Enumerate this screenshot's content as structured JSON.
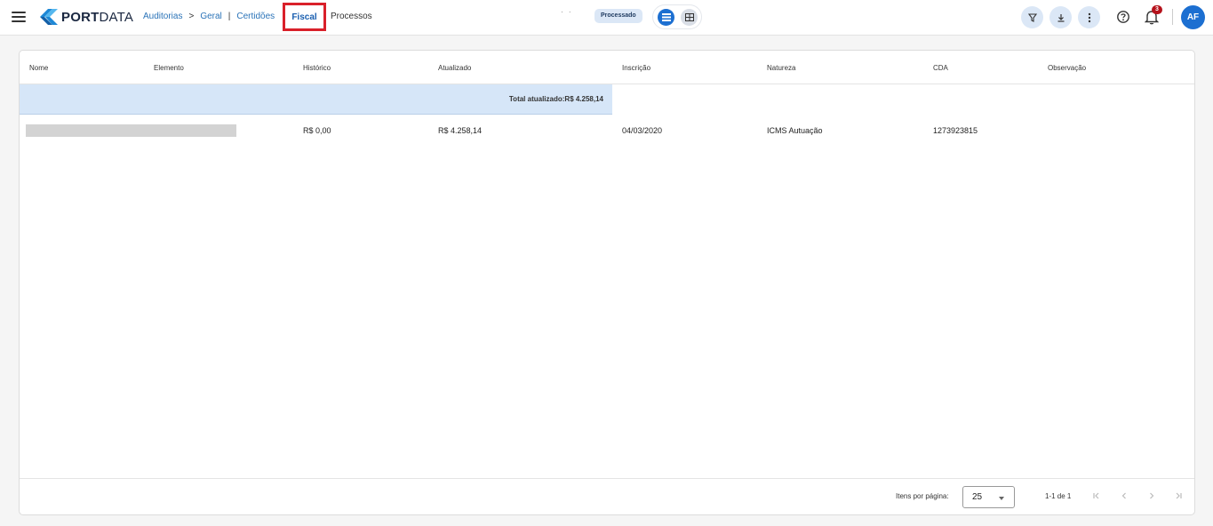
{
  "header": {
    "logo": {
      "part1": "PORT",
      "part2": "DATA"
    },
    "breadcrumb": {
      "auditorias": "Auditorias",
      "sep_arrow": ">",
      "geral": "Geral",
      "sep_bar1": "|",
      "certidoes": "Certidões",
      "fiscal": "Fiscal",
      "processos": "Processos"
    },
    "dots": "· ·",
    "status_chip": "Processado",
    "notification_count": "3",
    "avatar_initials": "AF"
  },
  "table": {
    "columns": [
      "Nome",
      "Elemento",
      "Histórico",
      "Atualizado",
      "Inscrição",
      "Natureza",
      "CDA",
      "Observação"
    ],
    "total_label": "Total atualizado:R$ 4.258,14",
    "rows": [
      {
        "historico": "R$ 0,00",
        "atualizado": "R$ 4.258,14",
        "inscricao": "04/03/2020",
        "natureza": "ICMS Autuação",
        "cda": "1273923815"
      }
    ]
  },
  "paginator": {
    "items_per_page_label": "Itens por página:",
    "items_per_page_value": "25",
    "range_label": "1-1 de 1"
  }
}
